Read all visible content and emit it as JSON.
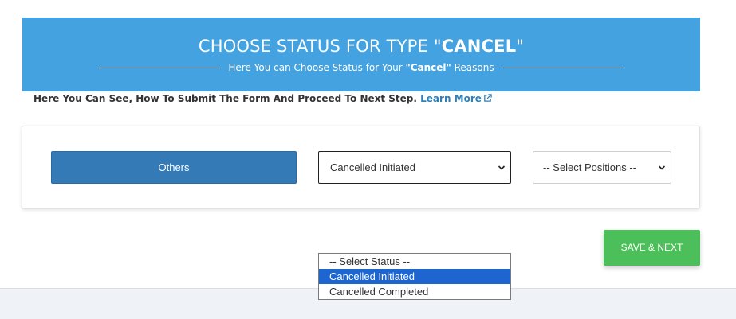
{
  "banner": {
    "title_prefix": "CHOOSE STATUS FOR TYPE \"",
    "title_type": "CANCEL",
    "title_suffix": "\"",
    "subtitle_prefix": "Here You can Choose Status for Your ",
    "subtitle_type": "\"Cancel\"",
    "subtitle_suffix": " Reasons",
    "color": "#44a2e0"
  },
  "help": {
    "text": "Here You Can See, How To Submit The Form And Proceed To Next Step.",
    "link_label": "Learn More",
    "link_icon": "external-link-icon"
  },
  "form": {
    "type_button_label": "Others",
    "status_select": {
      "value": "Cancelled Initiated",
      "options": [
        "-- Select Status --",
        "Cancelled Initiated",
        "Cancelled Completed"
      ],
      "highlighted": "Cancelled Initiated"
    },
    "position_select": {
      "value": "-- Select Positions --"
    }
  },
  "actions": {
    "save_label": "SAVE & NEXT",
    "save_color": "#4cbf5a"
  }
}
